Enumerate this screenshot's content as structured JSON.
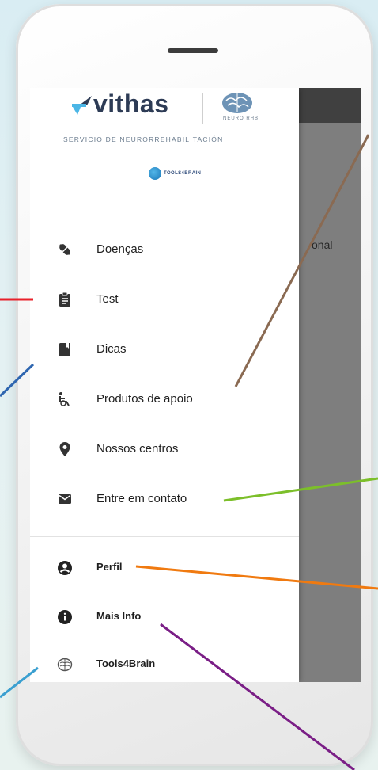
{
  "brand": {
    "name": "vithas",
    "service": "SERVICIO DE NEURORREHABILITACIÓN",
    "neuro": "NEURO RHB",
    "tools_badge": "TOOLS4BRAIN"
  },
  "background": {
    "partial_text": "onal"
  },
  "menu": {
    "items": [
      {
        "label": "Doenças",
        "icon": "disease-icon"
      },
      {
        "label": "Test",
        "icon": "clipboard-icon"
      },
      {
        "label": "Dicas",
        "icon": "book-icon"
      },
      {
        "label": "Produtos de apoio",
        "icon": "wheelchair-icon"
      },
      {
        "label": "Nossos centros",
        "icon": "location-pin-icon"
      },
      {
        "label": "Entre em contato",
        "icon": "mail-icon"
      },
      {
        "label": "Perfil",
        "icon": "account-circle-icon"
      },
      {
        "label": "Mais Info",
        "icon": "info-icon"
      },
      {
        "label": "Tools4Brain",
        "icon": "brain-icon"
      }
    ]
  },
  "annotation_colors": {
    "red": "#e8202a",
    "blue": "#2f66b0",
    "brown": "#8a6a52",
    "green": "#7cbf2a",
    "orange": "#f07a10",
    "purple": "#7a1e86",
    "light_blue": "#3a9fd0"
  }
}
